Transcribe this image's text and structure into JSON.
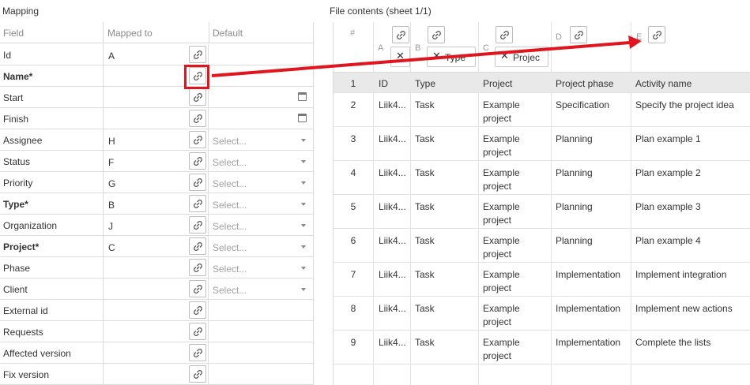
{
  "mapping": {
    "title": "Mapping",
    "headers": [
      "Field",
      "Mapped to",
      "Default"
    ],
    "select_placeholder": "Select...",
    "rows": [
      {
        "field": "Id",
        "mapped": "A",
        "required": false,
        "default": "none"
      },
      {
        "field": "Name*",
        "mapped": "",
        "required": true,
        "default": "none"
      },
      {
        "field": "Start",
        "mapped": "",
        "required": false,
        "default": "date"
      },
      {
        "field": "Finish",
        "mapped": "",
        "required": false,
        "default": "date"
      },
      {
        "field": "Assignee",
        "mapped": "H",
        "required": false,
        "default": "select"
      },
      {
        "field": "Status",
        "mapped": "F",
        "required": false,
        "default": "select"
      },
      {
        "field": "Priority",
        "mapped": "G",
        "required": false,
        "default": "select"
      },
      {
        "field": "Type*",
        "mapped": "B",
        "required": true,
        "default": "select"
      },
      {
        "field": "Organization",
        "mapped": "J",
        "required": false,
        "default": "select"
      },
      {
        "field": "Project*",
        "mapped": "C",
        "required": true,
        "default": "select"
      },
      {
        "field": "Phase",
        "mapped": "",
        "required": false,
        "default": "select"
      },
      {
        "field": "Client",
        "mapped": "",
        "required": false,
        "default": "select"
      },
      {
        "field": "External id",
        "mapped": "",
        "required": false,
        "default": "none"
      },
      {
        "field": "Requests",
        "mapped": "",
        "required": false,
        "default": "none"
      },
      {
        "field": "Affected version",
        "mapped": "",
        "required": false,
        "default": "none"
      },
      {
        "field": "Fix version",
        "mapped": "",
        "required": false,
        "default": "none"
      }
    ]
  },
  "file_contents": {
    "title": "File contents (sheet 1/1)",
    "row_number_header": "#",
    "column_letters": [
      "A",
      "B",
      "C",
      "D",
      "E"
    ],
    "mapped_tags": {
      "A": "",
      "B": "Type",
      "C": "Projec"
    },
    "rows": [
      {
        "num": "1",
        "cells": [
          "ID",
          "Type",
          "Project",
          "Project phase",
          "Activity name"
        ]
      },
      {
        "num": "2",
        "cells": [
          "Liik4...",
          "Task",
          "Example project",
          "Specification",
          "Specify the project idea"
        ]
      },
      {
        "num": "3",
        "cells": [
          "Liik4...",
          "Task",
          "Example project",
          "Planning",
          "Plan example 1"
        ]
      },
      {
        "num": "4",
        "cells": [
          "Liik4...",
          "Task",
          "Example project",
          "Planning",
          "Plan example 2"
        ]
      },
      {
        "num": "5",
        "cells": [
          "Liik4...",
          "Task",
          "Example project",
          "Planning",
          "Plan example 3"
        ]
      },
      {
        "num": "6",
        "cells": [
          "Liik4...",
          "Task",
          "Example project",
          "Planning",
          "Plan example 4"
        ]
      },
      {
        "num": "7",
        "cells": [
          "Liik4...",
          "Task",
          "Example project",
          "Implementation",
          "Implement integration"
        ]
      },
      {
        "num": "8",
        "cells": [
          "Liik4...",
          "Task",
          "Example project",
          "Implementation",
          "Implement new actions"
        ]
      },
      {
        "num": "9",
        "cells": [
          "Liik4...",
          "Task",
          "Example project",
          "Implementation",
          "Complete the lists"
        ]
      }
    ]
  },
  "colors": {
    "highlight": "#e0151d",
    "header_row_bg": "#e9e9e9",
    "border": "#d9d9d9"
  },
  "icons": {
    "link": "link-icon",
    "remove": "close-icon",
    "calendar": "calendar-icon",
    "dropdown": "chevron-down-icon"
  }
}
